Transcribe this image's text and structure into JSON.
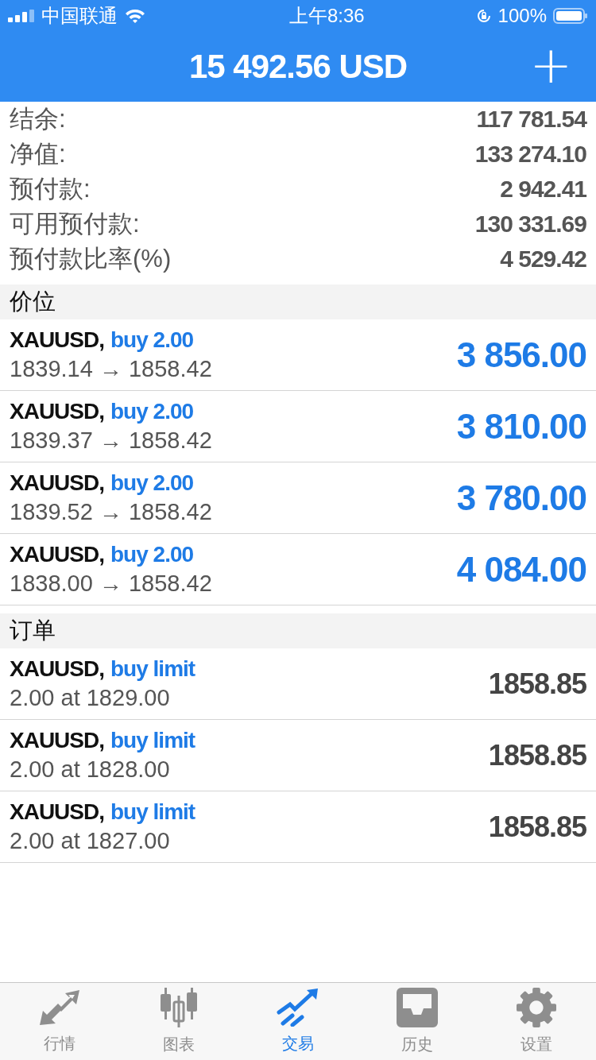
{
  "status_bar": {
    "carrier": "中国联通",
    "time": "上午8:36",
    "battery": "100%"
  },
  "header": {
    "title": "15 492.56 USD",
    "add": "+"
  },
  "summary": [
    {
      "label": "结余:",
      "value": "117 781.54"
    },
    {
      "label": "净值:",
      "value": "133 274.10"
    },
    {
      "label": "预付款:",
      "value": "2 942.41"
    },
    {
      "label": "可用预付款:",
      "value": "130 331.69"
    },
    {
      "label": "预付款比率(%)",
      "value": "4 529.42"
    }
  ],
  "positions": {
    "title": "价位",
    "rows": [
      {
        "symbol": "XAUUSD,",
        "type": "buy 2.00",
        "prices": "1839.14 → 1858.42",
        "profit": "3 856.00"
      },
      {
        "symbol": "XAUUSD,",
        "type": "buy 2.00",
        "prices": "1839.37 → 1858.42",
        "profit": "3 810.00"
      },
      {
        "symbol": "XAUUSD,",
        "type": "buy 2.00",
        "prices": "1839.52 → 1858.42",
        "profit": "3 780.00"
      },
      {
        "symbol": "XAUUSD,",
        "type": "buy 2.00",
        "prices": "1838.00 → 1858.42",
        "profit": "4 084.00"
      }
    ]
  },
  "orders": {
    "title": "订单",
    "rows": [
      {
        "symbol": "XAUUSD,",
        "type": "buy limit",
        "prices": "2.00 at 1829.00",
        "price": "1858.85"
      },
      {
        "symbol": "XAUUSD,",
        "type": "buy limit",
        "prices": "2.00 at 1828.00",
        "price": "1858.85"
      },
      {
        "symbol": "XAUUSD,",
        "type": "buy limit",
        "prices": "2.00 at 1827.00",
        "price": "1858.85"
      }
    ]
  },
  "tab_bar": [
    {
      "label": "行情",
      "selected": false
    },
    {
      "label": "图表",
      "selected": false
    },
    {
      "label": "交易",
      "selected": true
    },
    {
      "label": "历史",
      "selected": false
    },
    {
      "label": "设置",
      "selected": false
    }
  ]
}
